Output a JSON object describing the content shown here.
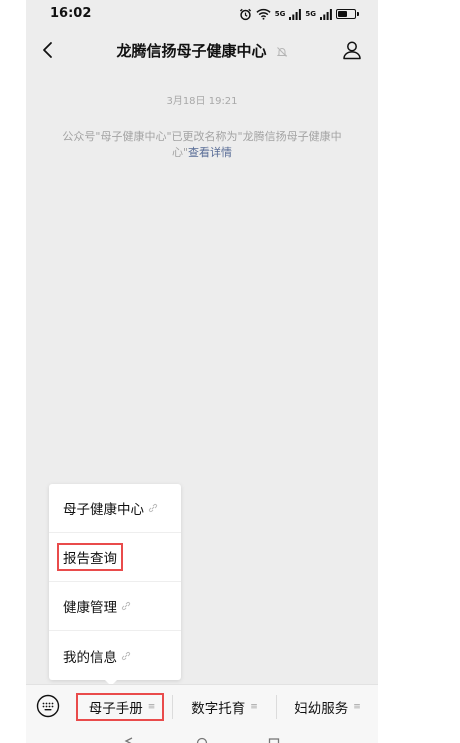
{
  "status_bar": {
    "time": "16:02",
    "net_1": "5G",
    "net_2": "5G",
    "battery_level": 0.65
  },
  "nav": {
    "title": "龙腾信扬母子健康中心"
  },
  "chat": {
    "date": "3月18日 19:21",
    "notice_text": "公众号\"母子健康中心\"已更改名称为\"龙腾信扬母子健康中心\"",
    "notice_link": "查看详情"
  },
  "popup_menu": {
    "items": [
      {
        "label": "母子健康中心"
      },
      {
        "label": "报告查询"
      },
      {
        "label": "健康管理"
      },
      {
        "label": "我的信息"
      }
    ]
  },
  "menu_bar": {
    "tabs": [
      {
        "label": "母子手册"
      },
      {
        "label": "数字托育"
      },
      {
        "label": "妇幼服务"
      }
    ]
  },
  "colors": {
    "highlight": "#e94b4b",
    "link": "#576b95",
    "background": "#ededed"
  }
}
